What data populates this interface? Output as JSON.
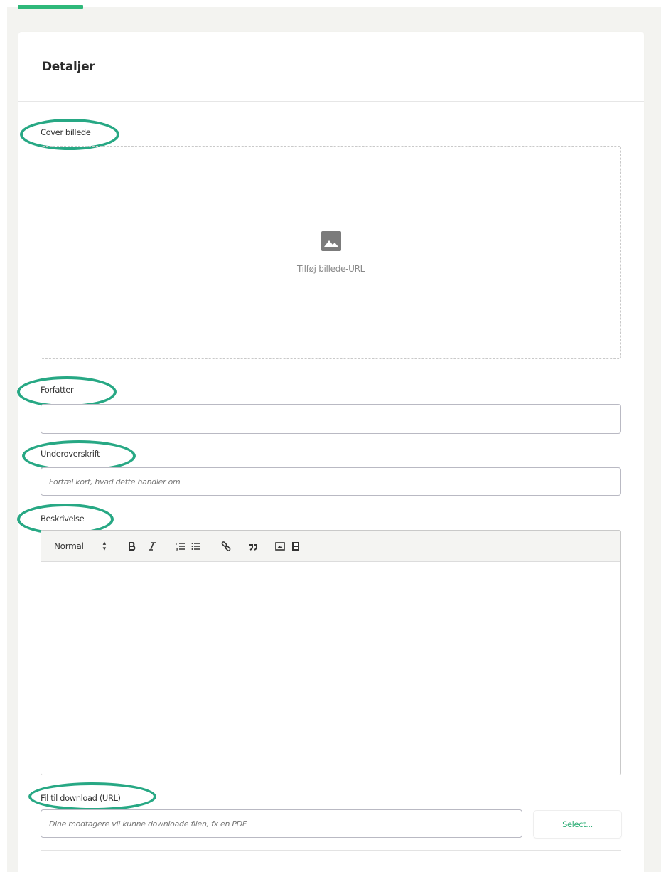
{
  "section": {
    "title": "Detaljer"
  },
  "cover": {
    "label": "Cover billede",
    "dropzone_text": "Tilføj billede-URL",
    "icon": "image-icon"
  },
  "author": {
    "label": "Forfatter",
    "value": "",
    "placeholder": ""
  },
  "subtitle": {
    "label": "Underoverskrift",
    "value": "",
    "placeholder": "Fortæl kort, hvad dette handler om"
  },
  "description": {
    "label": "Beskrivelse",
    "toolbar": {
      "format_value": "Normal",
      "buttons": [
        "bold-icon",
        "italic-icon",
        "ordered-list-icon",
        "bullet-list-icon",
        "link-icon",
        "quote-icon",
        "image-icon",
        "video-icon"
      ]
    },
    "value": ""
  },
  "download": {
    "label": "Fil til download (URL)",
    "value": "",
    "placeholder": "Dine modtagere vil kunne downloade filen, fx en PDF",
    "select_label": "Select..."
  },
  "colors": {
    "accent": "#2fb87a",
    "highlight": "#27a884",
    "background": "#f3f3f0"
  }
}
